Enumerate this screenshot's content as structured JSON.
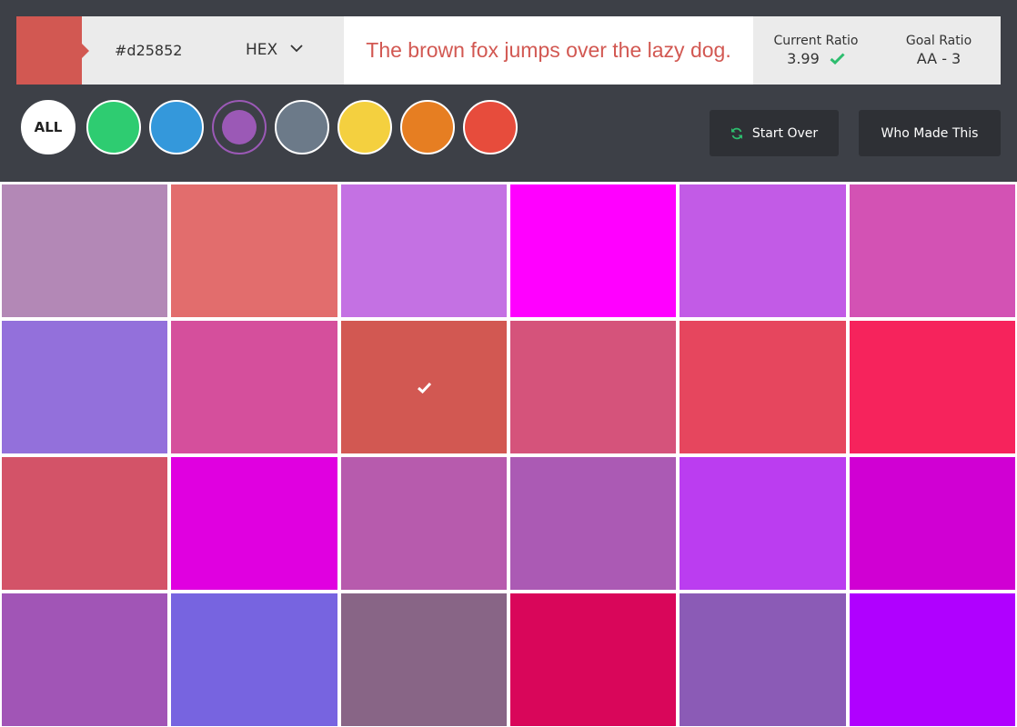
{
  "selected": {
    "color": "#d25852",
    "hex": "#d25852",
    "format": "HEX"
  },
  "preview": {
    "text": "The brown fox jumps over the lazy dog.",
    "text_color": "#d25852"
  },
  "ratios": {
    "current_label": "Current Ratio",
    "current_value": "3.99",
    "current_status_icon": "check-icon",
    "goal_label": "Goal Ratio",
    "goal_value": "AA - 3"
  },
  "filters": {
    "all_label": "ALL",
    "colors": [
      {
        "name": "green",
        "color": "#2ecc71",
        "active": false
      },
      {
        "name": "blue",
        "color": "#3498db",
        "active": false
      },
      {
        "name": "purple",
        "color": "#9b59b6",
        "active": true
      },
      {
        "name": "gray",
        "color": "#6c7a89",
        "active": false
      },
      {
        "name": "yellow",
        "color": "#f4d03f",
        "active": false
      },
      {
        "name": "orange",
        "color": "#e67e22",
        "active": false
      },
      {
        "name": "red",
        "color": "#e74c3c",
        "active": false
      }
    ]
  },
  "buttons": {
    "start_over": "Start Over",
    "start_over_icon": "refresh-icon",
    "who_made_this": "Who Made This"
  },
  "colors": {
    "header_bg": "#3d4047",
    "button_bg": "#2e3035",
    "accent_green": "#2dbd6e"
  },
  "palette": [
    [
      "#b388b6",
      "#e26d6d",
      "#c471e3",
      "#ff00ff",
      "#c25be6",
      "#d352b4"
    ],
    [
      "#9370db",
      "#d54f9c",
      "#d25852",
      "#d5537b",
      "#e6465e",
      "#f6235c"
    ],
    [
      "#d35368",
      "#e000e0",
      "#b75bad",
      "#ab5ab4",
      "#bb3df0",
      "#d000d3"
    ],
    [
      "#a155b6",
      "#7764e0",
      "#886586",
      "#d9065a",
      "#8b5bb6",
      "#b000ff"
    ]
  ],
  "selected_cell": {
    "row": 1,
    "col": 2
  }
}
